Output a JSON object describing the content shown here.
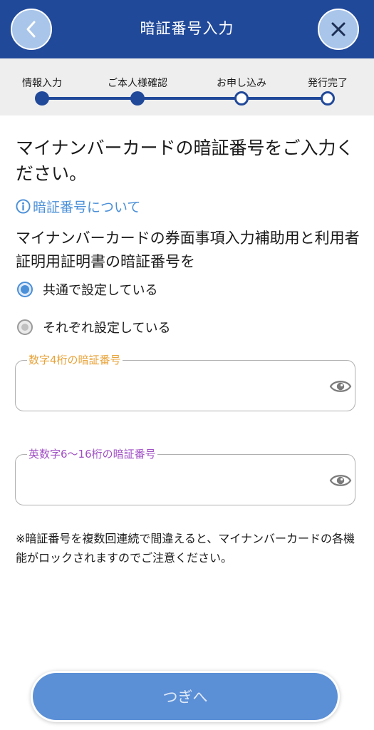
{
  "header": {
    "title": "暗証番号入力",
    "back_icon": "chevron-left-icon",
    "close_icon": "close-icon",
    "bg_color": "#21499a"
  },
  "stepper": {
    "steps": [
      {
        "label": "情報入力",
        "state": "done"
      },
      {
        "label": "ご本人様確認",
        "state": "done"
      },
      {
        "label": "お申し込み",
        "state": "todo"
      },
      {
        "label": "発行完了",
        "state": "todo"
      }
    ]
  },
  "main": {
    "heading": "マイナンバーカードの暗証番号をご入力ください。",
    "info_link": "暗証番号について",
    "question": "マイナンバーカードの券面事項入力補助用と利用者証明用証明書の暗証番号を",
    "options": [
      {
        "label": "共通で設定している",
        "selected": true
      },
      {
        "label": "それぞれ設定している",
        "selected": false
      }
    ],
    "fields": [
      {
        "legend": "数字4桁の暗証番号",
        "value": "",
        "legend_color": "#e8a33a"
      },
      {
        "legend": "英数字6〜16桁の暗証番号",
        "value": "",
        "legend_color": "#a04fc4"
      }
    ],
    "notice": "※暗証番号を複数回連続で間違えると、マイナンバーカードの各機能がロックされますのでご注意ください。"
  },
  "footer": {
    "next_label": "つぎへ",
    "accent_color": "#4a8fd8"
  }
}
